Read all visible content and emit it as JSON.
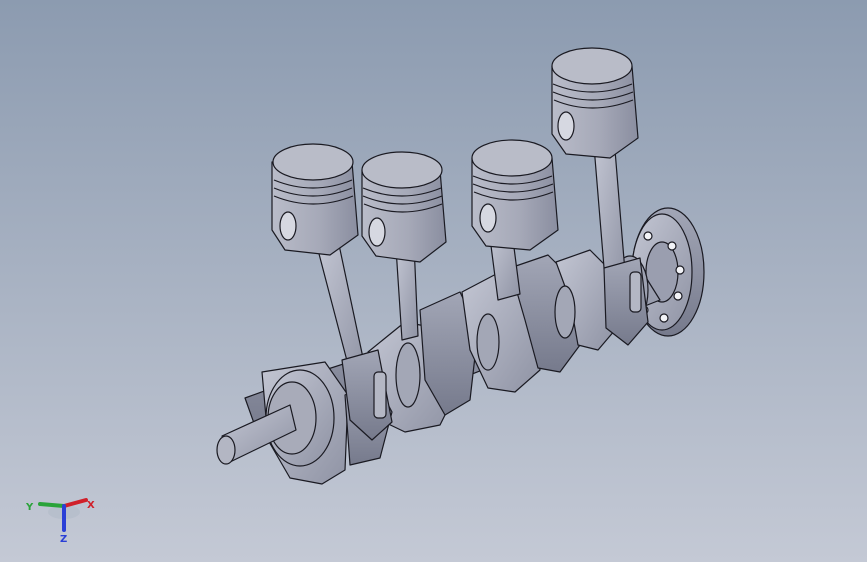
{
  "triad": {
    "x_label": "X",
    "y_label": "Y",
    "z_label": "Z",
    "x_color": "#d0202a",
    "y_color": "#2aa33a",
    "z_color": "#2a3fd6"
  },
  "scene": {
    "background_top": "#8c9bb0",
    "background_bottom": "#c4c9d5",
    "part_color": "#a7aab8",
    "edge_color": "#1a1a22"
  }
}
